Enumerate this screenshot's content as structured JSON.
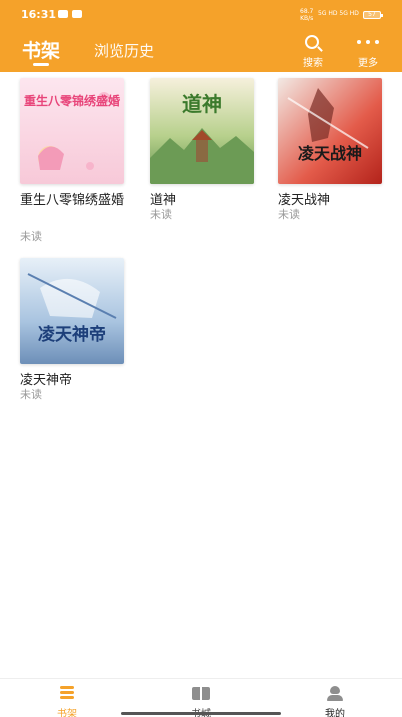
{
  "status_bar": {
    "time": "16:31",
    "net_rate_value": "68.7",
    "net_rate_unit": "KB/s",
    "network": "5G HD 5G HD",
    "battery": "57"
  },
  "header": {
    "tabs": [
      {
        "label": "书架",
        "active": true
      },
      {
        "label": "浏览历史",
        "active": false
      }
    ],
    "actions": [
      {
        "label": "搜索",
        "icon": "search-icon"
      },
      {
        "label": "更多",
        "icon": "more-dots-icon"
      }
    ],
    "accent_color": "#F5A22A"
  },
  "books": [
    {
      "title": "重生八零锦绣盛婚",
      "status": "未读",
      "cover_palette": "pink"
    },
    {
      "title": "道神",
      "status": "未读",
      "cover_palette": "green"
    },
    {
      "title": "凌天战神",
      "status": "未读",
      "cover_palette": "red"
    },
    {
      "title": "凌天神帝",
      "status": "未读",
      "cover_palette": "blue"
    }
  ],
  "bottom_nav": [
    {
      "label": "书架",
      "icon": "bookshelf-icon",
      "active": true
    },
    {
      "label": "书城",
      "icon": "bookstore-icon",
      "active": false
    },
    {
      "label": "我的",
      "icon": "profile-icon",
      "active": false
    }
  ],
  "colors": {
    "accent": "#F5A22A",
    "inactive": "#8e8e8e",
    "muted_text": "#9a9a9a"
  }
}
